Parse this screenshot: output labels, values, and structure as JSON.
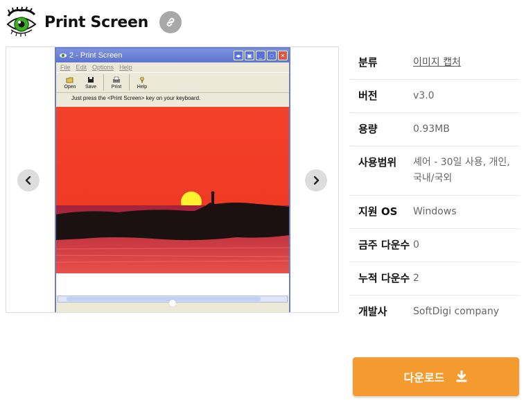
{
  "app": {
    "title": "Print Screen",
    "logo_icon": "eye-icon",
    "link_icon": "link-icon"
  },
  "gallery": {
    "prev_icon": "chevron-left-icon",
    "next_icon": "chevron-right-icon",
    "screenshot": {
      "window_title": "2 - Print Screen",
      "menu": [
        "File",
        "Edit",
        "Options",
        "Help"
      ],
      "toolbar": [
        "Open",
        "Save",
        "Print",
        "Help"
      ],
      "hint": "Just press the <Print Screen> key on your keyboard."
    }
  },
  "info": {
    "rows": [
      {
        "label": "분류",
        "value": "이미지 캡처"
      },
      {
        "label": "버전",
        "value": "v3.0"
      },
      {
        "label": "용량",
        "value": "0.93MB"
      },
      {
        "label": "사용범위",
        "value": "셰어 - 30일 사용, 개인, 국내/국외"
      },
      {
        "label": "지원 OS",
        "value": "Windows"
      },
      {
        "label": "금주 다운수",
        "value": "0"
      },
      {
        "label": "누적 다운수",
        "value": "2"
      },
      {
        "label": "개발사",
        "value": "SoftDigi company"
      }
    ]
  },
  "download": {
    "label": "다운로드",
    "icon": "download-icon",
    "color": "#f59a2f"
  }
}
